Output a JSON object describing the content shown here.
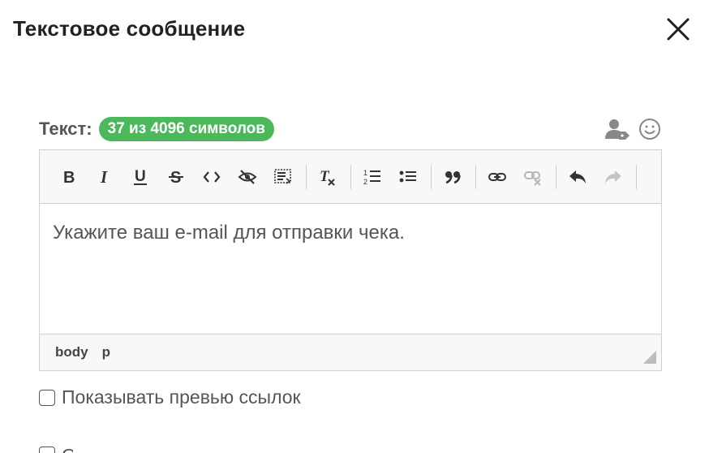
{
  "dialog": {
    "title": "Текстовое сообщение",
    "close_icon": "close-icon"
  },
  "text_field": {
    "label": "Текст:",
    "counter": "37 из 4096 символов",
    "counter_color": "#4cb85c",
    "icons": [
      "personalization-icon",
      "emoji-icon"
    ]
  },
  "toolbar": {
    "buttons": [
      {
        "name": "bold",
        "icon": "bold-icon"
      },
      {
        "name": "italic",
        "icon": "italic-icon"
      },
      {
        "name": "underline",
        "icon": "underline-icon"
      },
      {
        "name": "strikethrough",
        "icon": "strikethrough-icon"
      },
      {
        "name": "code",
        "icon": "code-icon"
      },
      {
        "name": "spoiler",
        "icon": "eye-slash-icon"
      },
      {
        "name": "show-blocks",
        "icon": "show-blocks-icon"
      },
      {
        "name": "remove-format",
        "icon": "remove-format-icon"
      },
      {
        "name": "numbered-list",
        "icon": "numbered-list-icon"
      },
      {
        "name": "bulleted-list",
        "icon": "bulleted-list-icon"
      },
      {
        "name": "blockquote",
        "icon": "quote-icon"
      },
      {
        "name": "link",
        "icon": "link-icon"
      },
      {
        "name": "unlink",
        "icon": "unlink-icon",
        "disabled": true
      },
      {
        "name": "undo",
        "icon": "undo-icon"
      },
      {
        "name": "redo",
        "icon": "redo-icon",
        "disabled": true
      }
    ]
  },
  "editor": {
    "content": "Укажите ваш e-mail для отправки чека.",
    "path": [
      "body",
      "p"
    ]
  },
  "options": {
    "preview_links_label": "Показывать превью ссылок",
    "preview_links_checked": false,
    "next_option_label_visible": "О"
  }
}
